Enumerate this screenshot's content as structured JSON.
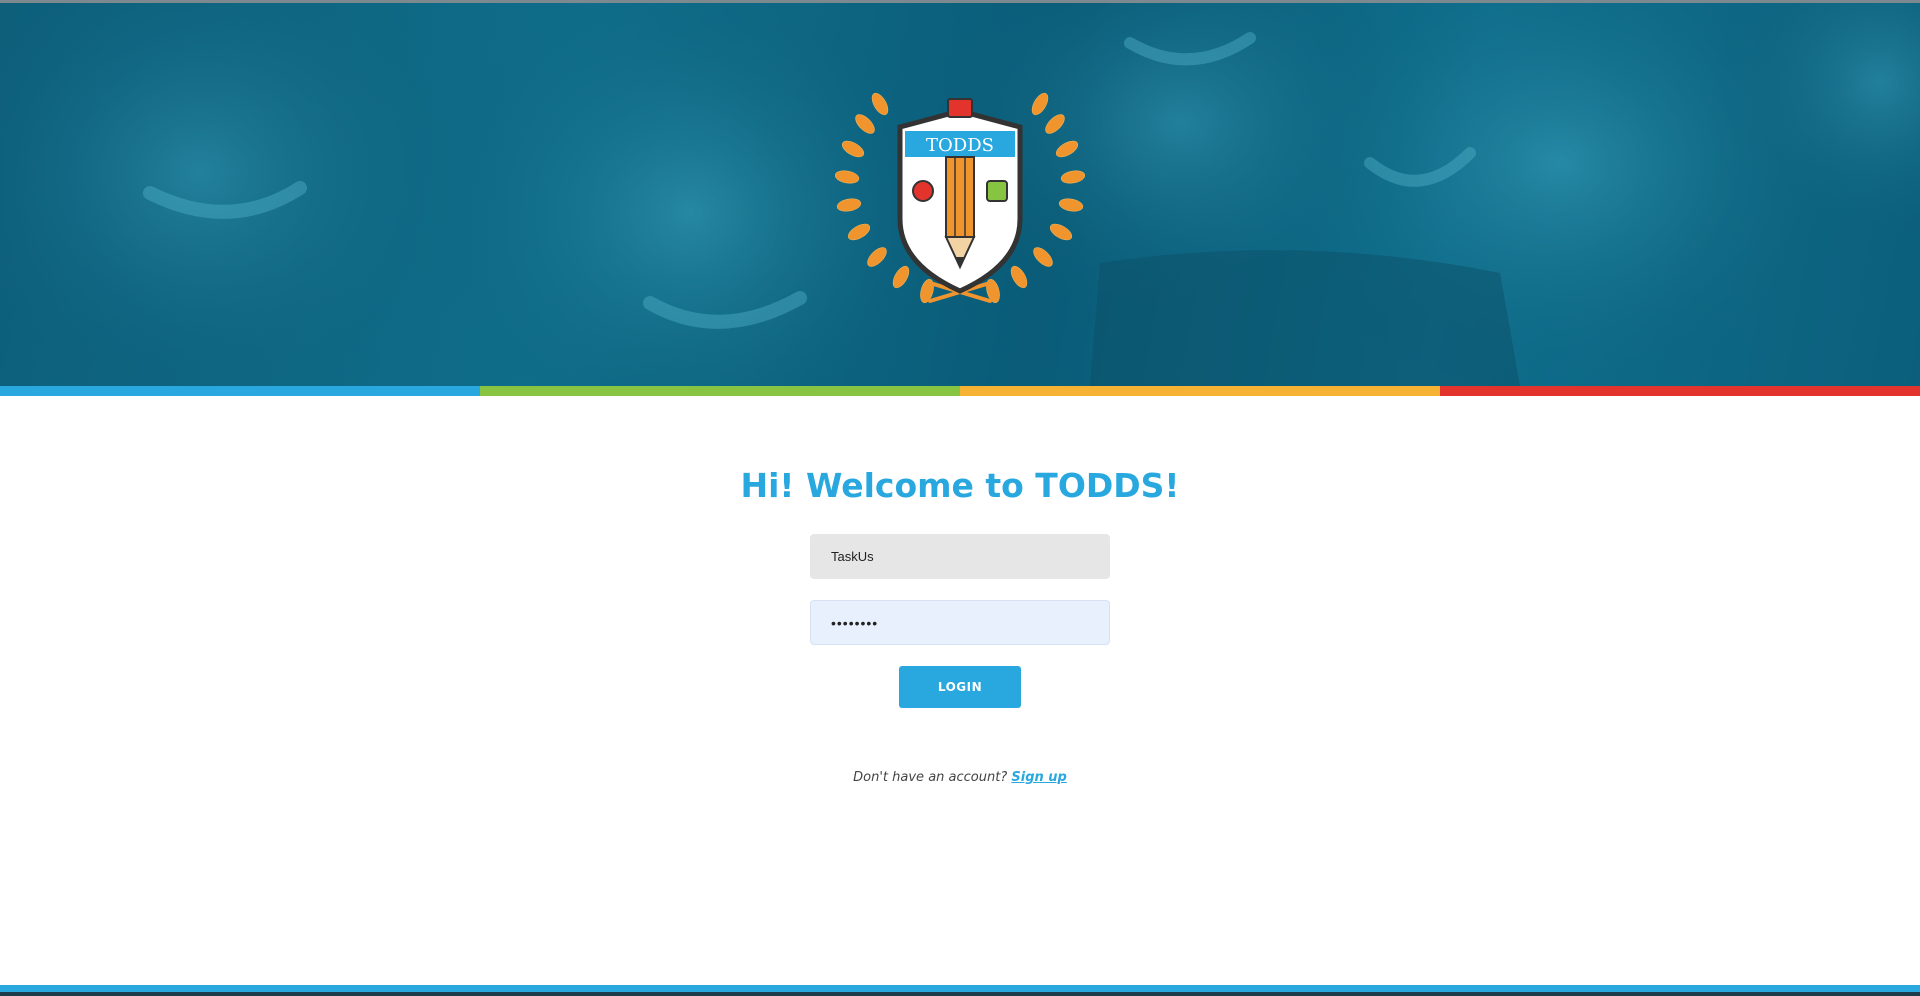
{
  "hero": {
    "logo": {
      "text": "TODDS",
      "icon": "todds-crest-logo"
    }
  },
  "color_bar": {
    "colors": [
      "#29a8df",
      "#86c441",
      "#f6b333",
      "#e2342d"
    ]
  },
  "login": {
    "title": "Hi! Welcome to TODDS!",
    "username_value": "TaskUs",
    "password_value": "••••••••",
    "login_label": "LOGIN",
    "signup_prompt": "Don't have an account?",
    "signup_link": "Sign up"
  },
  "colors": {
    "accent": "#29a8df",
    "hero_overlay": "#0f6d8a"
  }
}
